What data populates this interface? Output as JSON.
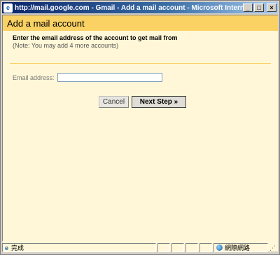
{
  "window": {
    "title": "http://mail.google.com - Gmail - Add a mail account - Microsoft Internet Explorer",
    "icon": "ie-logo-icon",
    "buttons": {
      "minimize": "_",
      "maximize": "□",
      "close": "×"
    }
  },
  "dialog": {
    "heading": "Add a mail account",
    "instruction": "Enter the email address of the account to get mail from",
    "note": "(Note: You may add 4 more accounts)",
    "email_label": "Email address:",
    "email_value": "",
    "cancel_label": "Cancel",
    "next_label": "Next Step »"
  },
  "statusbar": {
    "status_text": "完成",
    "zone_text": "網際網路"
  },
  "colors": {
    "header_bg": "#fad163",
    "panel_bg": "#fff7d7",
    "titlebar_start": "#0a246a"
  }
}
